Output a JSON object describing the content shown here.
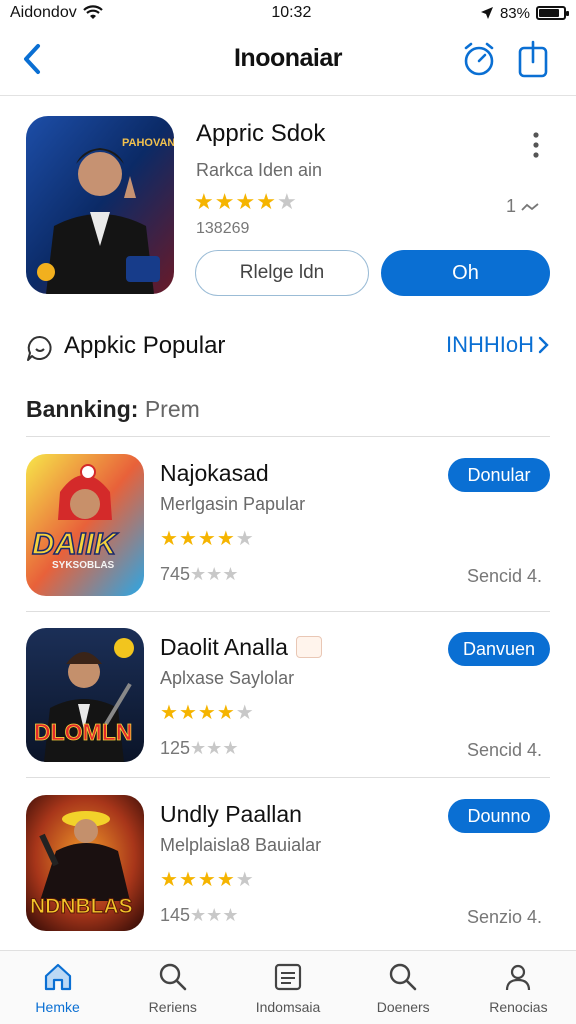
{
  "status_bar": {
    "carrier": "Aidondov",
    "time": "10:32",
    "battery": "83%",
    "battery_level": 0.83
  },
  "nav": {
    "title": "Inoonaiar"
  },
  "featured": {
    "title": "Appric Sdok",
    "subtitle": "Rarkca Iden ain",
    "stars": 4,
    "count": "138269",
    "rank": "1",
    "secondary_button": "Rlelge ldn",
    "primary_button": "Oh",
    "icon_text": "PAHOVAN"
  },
  "section": {
    "title": "Appkic Popular",
    "link": "INHHIoH"
  },
  "category": {
    "bold": "Bannking:",
    "rest": "Prem"
  },
  "apps": [
    {
      "name": "Najokasad",
      "subtitle": "Merlgasin Papular",
      "stars": 4,
      "rating": "745",
      "button": "Donular",
      "meta": "Sencid 4.",
      "icon_text": "DAIIK",
      "icon_subtext": "SYKSOBLAS"
    },
    {
      "name": "Daolit Analla",
      "subtitle": "Aplxase Saylolar",
      "stars": 4,
      "rating": "125",
      "button": "Danvuen",
      "meta": "Sencid 4.",
      "icon_text": "DLOMLN"
    },
    {
      "name": "Undly Paallan",
      "subtitle": "Melplaisla8 Bauialar",
      "stars": 4,
      "rating": "145",
      "button": "Dounno",
      "meta": "Senzio 4.",
      "icon_text": "NDNBLAS"
    }
  ],
  "tabs": [
    {
      "label": "Hemke",
      "icon": "home-icon",
      "active": true
    },
    {
      "label": "Reriens",
      "icon": "search-icon",
      "active": false
    },
    {
      "label": "Indomsaia",
      "icon": "list-icon",
      "active": false
    },
    {
      "label": "Doeners",
      "icon": "search-icon",
      "active": false
    },
    {
      "label": "Renocias",
      "icon": "person-icon",
      "active": false
    }
  ],
  "colors": {
    "accent": "#0a6fd3",
    "star": "#f5b400"
  }
}
